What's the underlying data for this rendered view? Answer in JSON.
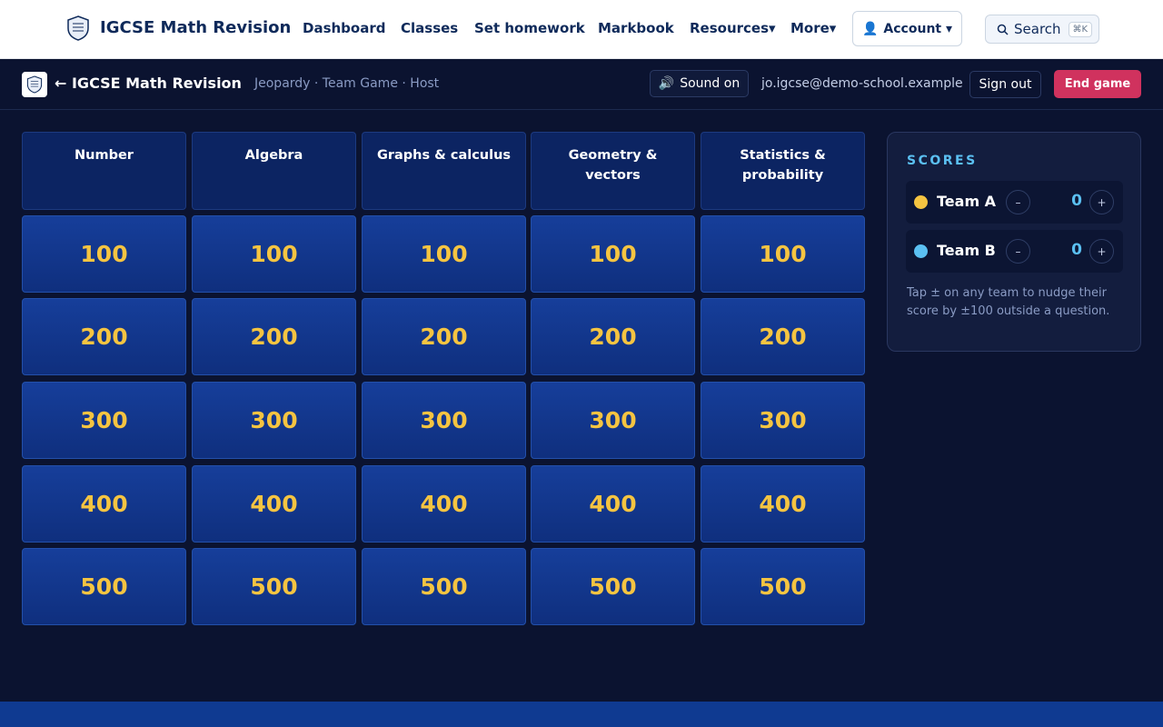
{
  "nav": {
    "brand": "IGCSE Math Revision",
    "links": [
      "Dashboard",
      "Classes",
      "Set homework",
      "Markbook",
      "Resources▾",
      "More▾"
    ],
    "account_icon": "👤",
    "account_label": "Account ▾",
    "search_label": "Search",
    "search_shortcut": "⌘K"
  },
  "game": {
    "back_title": "← IGCSE Math Revision",
    "subtitle": "Jeopardy · Team Game · Host",
    "sound_icon": "🔊",
    "sound_label": "Sound on",
    "email": "jo.igcse@demo-school.example",
    "signout": "Sign out",
    "end_game": "End game"
  },
  "board": {
    "categories": [
      "Number",
      "Algebra",
      "Graphs & calculus",
      "Geometry & vectors",
      "Statistics & probability"
    ],
    "values": [
      "100",
      "200",
      "300",
      "400",
      "500"
    ]
  },
  "scores": {
    "title": "SCORES",
    "minus": "–",
    "plus": "+",
    "teams": [
      {
        "name": "Team A",
        "score": "0",
        "color": "#f5c441"
      },
      {
        "name": "Team B",
        "score": "0",
        "color": "#5bc0f2"
      }
    ],
    "hint": "Tap ± on any team to nudge their score by ±100 outside a question."
  },
  "colors": {
    "accent": "#d0325e",
    "board_value": "#f5c441",
    "score_accent": "#5bc0f2"
  }
}
